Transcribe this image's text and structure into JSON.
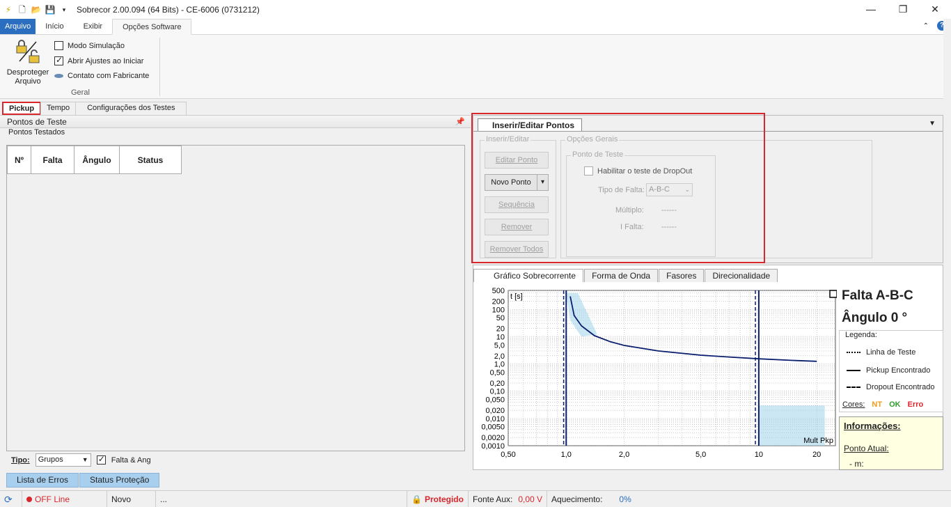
{
  "window": {
    "title": "Sobrecor 2.00.094 (64 Bits) - CE-6006 (0731212)",
    "controls": [
      "—",
      "❐",
      "✕"
    ]
  },
  "ribbon_tabs": [
    "Arquivo",
    "Início",
    "Exibir",
    "Opções Software"
  ],
  "ribbon": {
    "unprotect_label": "Desproteger Arquivo",
    "options": [
      {
        "label": "Modo Simulação",
        "checked": false
      },
      {
        "label": "Abrir Ajustes ao Iniciar",
        "checked": true
      },
      {
        "label": "Contato com Fabricante"
      }
    ],
    "group_label": "Geral"
  },
  "left_tabs": [
    "Pickup",
    "Tempo",
    "Configurações dos Testes"
  ],
  "left_panel": {
    "header": "Pontos de Teste",
    "subheader": "Pontos Testados",
    "columns": [
      "Nº",
      "Falta",
      "Ângulo",
      "Status"
    ],
    "tipo_label": "Tipo:",
    "tipo_value": "Grupos",
    "falta_ang_label": "Falta & Ang",
    "falta_ang_checked": true
  },
  "bottom_tabs": [
    "Lista de Erros",
    "Status Proteção"
  ],
  "status_bar": {
    "connection": "OFF Line",
    "state": "Novo",
    "dots": "...",
    "protected": "Protegido",
    "fonte_aux_label": "Fonte Aux:",
    "fonte_aux_value": "0,00 V",
    "aquecimento_label": "Aquecimento:",
    "aquecimento_value": "0%"
  },
  "insert_panel": {
    "tab": "Inserir/Editar Pontos",
    "group_insert": "Inserir/Editar",
    "group_general": "Opções Gerais",
    "group_point": "Ponto de Teste",
    "buttons": [
      "Editar Ponto",
      "Novo Ponto",
      "Sequência",
      "Remover",
      "Remover Todos"
    ],
    "dropout_label": "Habilitar o teste de DropOut",
    "tipo_falta_label": "Tipo de Falta:",
    "tipo_falta_value": "A-B-C",
    "multiplo_label": "Múltiplo:",
    "multiplo_value": "------",
    "ifalta_label": "I Falta:",
    "ifalta_value": "------"
  },
  "chart_tabs": [
    "Gráfico Sobrecorrente",
    "Forma de Onda",
    "Fasores",
    "Direcionalidade"
  ],
  "chart_side": {
    "falta": "Falta A-B-C",
    "angulo": "Ângulo 0 °",
    "legenda": "Legenda:",
    "legend_items": [
      "Linha de Teste",
      "Pickup Encontrado",
      "Dropout Encontrado"
    ],
    "cores_label": "Cores:",
    "cores": [
      {
        "label": "NT",
        "color": "#f39c12"
      },
      {
        "label": "OK",
        "color": "#2e9e2e"
      },
      {
        "label": "Erro",
        "color": "#d9262c"
      }
    ],
    "info_title": "Informações:",
    "ponto_atual": "Ponto Atual:",
    "m_label": "- m:"
  },
  "chart_data": {
    "type": "line",
    "xscale": "log",
    "yscale": "log",
    "xlim": [
      0.5,
      25
    ],
    "ylim": [
      0.001,
      500
    ],
    "ylabel": "t [s]",
    "xlabel": "Mult Pkp",
    "xticks": [
      "0,50",
      "1,0",
      "2,0",
      "5,0",
      "10",
      "20"
    ],
    "xtick_values": [
      0.5,
      1,
      2,
      5,
      10,
      20
    ],
    "yticks": [
      "500",
      "200",
      "100",
      "50",
      "20",
      "10",
      "5,0",
      "2,0",
      "1,0",
      "0,50",
      "0,20",
      "0,10",
      "0,050",
      "0,020",
      "0,010",
      "0,0050",
      "0,0020",
      "0,0010"
    ],
    "ytick_values": [
      500,
      200,
      100,
      50,
      20,
      10,
      5,
      2,
      1,
      0.5,
      0.2,
      0.1,
      0.05,
      0.02,
      0.01,
      0.005,
      0.002,
      0.001
    ],
    "series": [
      {
        "x": [
          1.05,
          1.1,
          1.2,
          1.4,
          1.7,
          2.0,
          3.0,
          5.0,
          7.0,
          10.0,
          15.0,
          20.0
        ],
        "y": [
          300,
          60,
          25,
          11,
          6.5,
          4.8,
          3.0,
          2.1,
          1.8,
          1.55,
          1.35,
          1.25
        ]
      }
    ],
    "pickup_lines": [
      1.0,
      10.0
    ],
    "dropout_lines": [
      0.97,
      9.6
    ]
  }
}
